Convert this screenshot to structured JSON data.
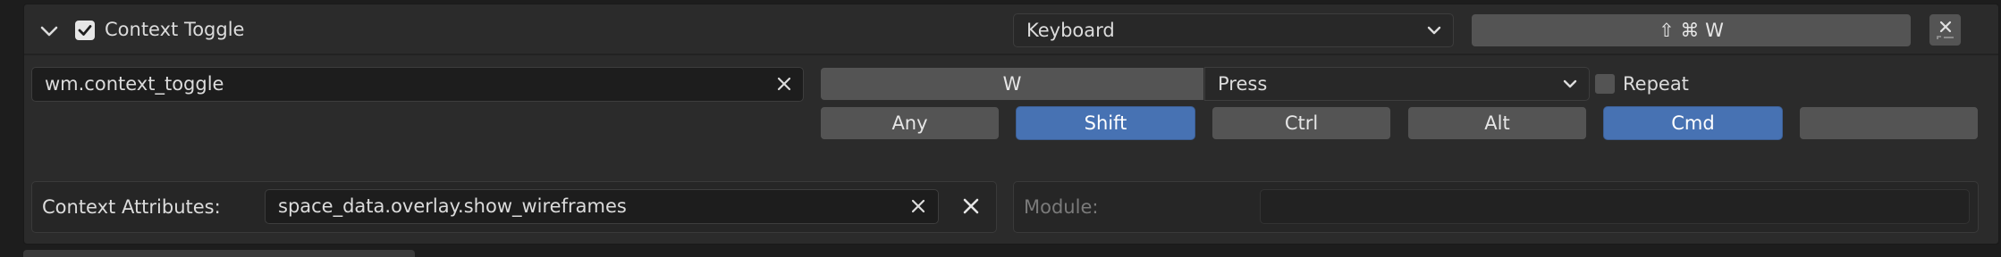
{
  "header": {
    "title": "Context Toggle",
    "enabled": true,
    "input_type": "Keyboard",
    "shortcut_display": "⇧ ⌘ W"
  },
  "operator": {
    "idname": "wm.context_toggle"
  },
  "keymap": {
    "key": "W",
    "event_value": "Press",
    "repeat_label": "Repeat",
    "repeat_checked": false,
    "modifiers": [
      {
        "label": "Any",
        "active": false
      },
      {
        "label": "Shift",
        "active": true
      },
      {
        "label": "Ctrl",
        "active": false
      },
      {
        "label": "Alt",
        "active": false
      },
      {
        "label": "Cmd",
        "active": true
      },
      {
        "label": "",
        "active": false
      }
    ]
  },
  "properties": {
    "context_label": "Context Attributes:",
    "context_value": "space_data.overlay.show_wireframes",
    "module_label": "Module:",
    "module_value": ""
  },
  "colors": {
    "accent": "#4772b3",
    "panel": "#2b2b2b",
    "field": "#1d1d1d",
    "button": "#545454"
  },
  "icons": [
    "chevron-down-icon",
    "checkbox-icon",
    "remove-icon",
    "clear-icon"
  ]
}
